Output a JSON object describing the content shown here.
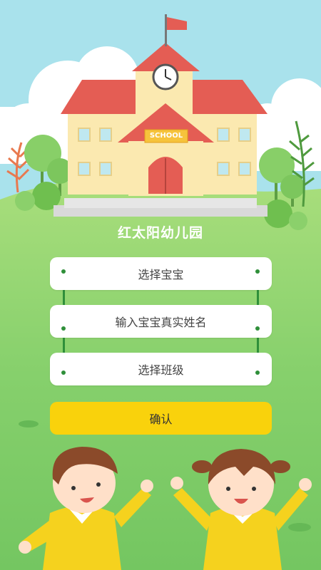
{
  "school": {
    "name": "红太阳幼儿园",
    "sign": "SCHOOL"
  },
  "form": {
    "select_baby": "选择宝宝",
    "baby_name_placeholder": "输入宝宝真实姓名",
    "select_class": "选择班级",
    "confirm_label": "确认"
  },
  "colors": {
    "sky": "#a9e2ec",
    "grass": "#7fcf6a",
    "confirm": "#f9d20c",
    "rope": "#2f8f3a"
  }
}
